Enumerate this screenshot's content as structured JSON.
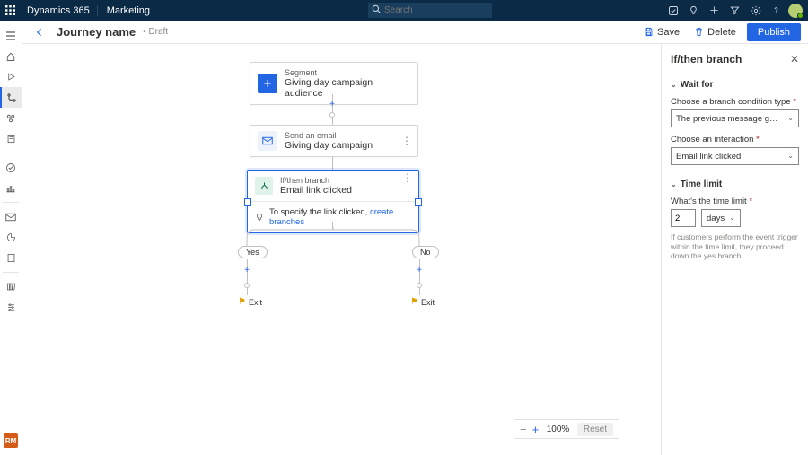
{
  "header": {
    "product": "Dynamics 365",
    "area": "Marketing",
    "search_placeholder": "Search"
  },
  "commandbar": {
    "page_title": "Journey name",
    "status": "Draft",
    "save_label": "Save",
    "delete_label": "Delete",
    "publish_label": "Publish"
  },
  "leftnav": {
    "bottom_badge": "RM"
  },
  "journey": {
    "segment": {
      "label": "Segment",
      "value": "Giving day campaign audience"
    },
    "email": {
      "label": "Send an email",
      "value": "Giving day campaign"
    },
    "ifthen": {
      "label": "If/then branch",
      "value": "Email link clicked",
      "hint_prefix": "To specify the link clicked, ",
      "hint_link": "create branches"
    },
    "branches": {
      "yes": "Yes",
      "no": "No",
      "exit": "Exit"
    }
  },
  "right_pane": {
    "title": "If/then branch",
    "wait_for": {
      "section": "Wait for",
      "cond_label": "Choose a branch condition type",
      "cond_value": "The previous message gets an interaction",
      "interaction_label": "Choose an interaction",
      "interaction_value": "Email link clicked"
    },
    "time_limit": {
      "section": "Time limit",
      "label": "What's the time limit",
      "value": "2",
      "unit": "days",
      "help": "If customers perform the event trigger within the time limit, they proceed down the yes branch"
    }
  },
  "zoom": {
    "value": "100%",
    "reset": "Reset"
  }
}
